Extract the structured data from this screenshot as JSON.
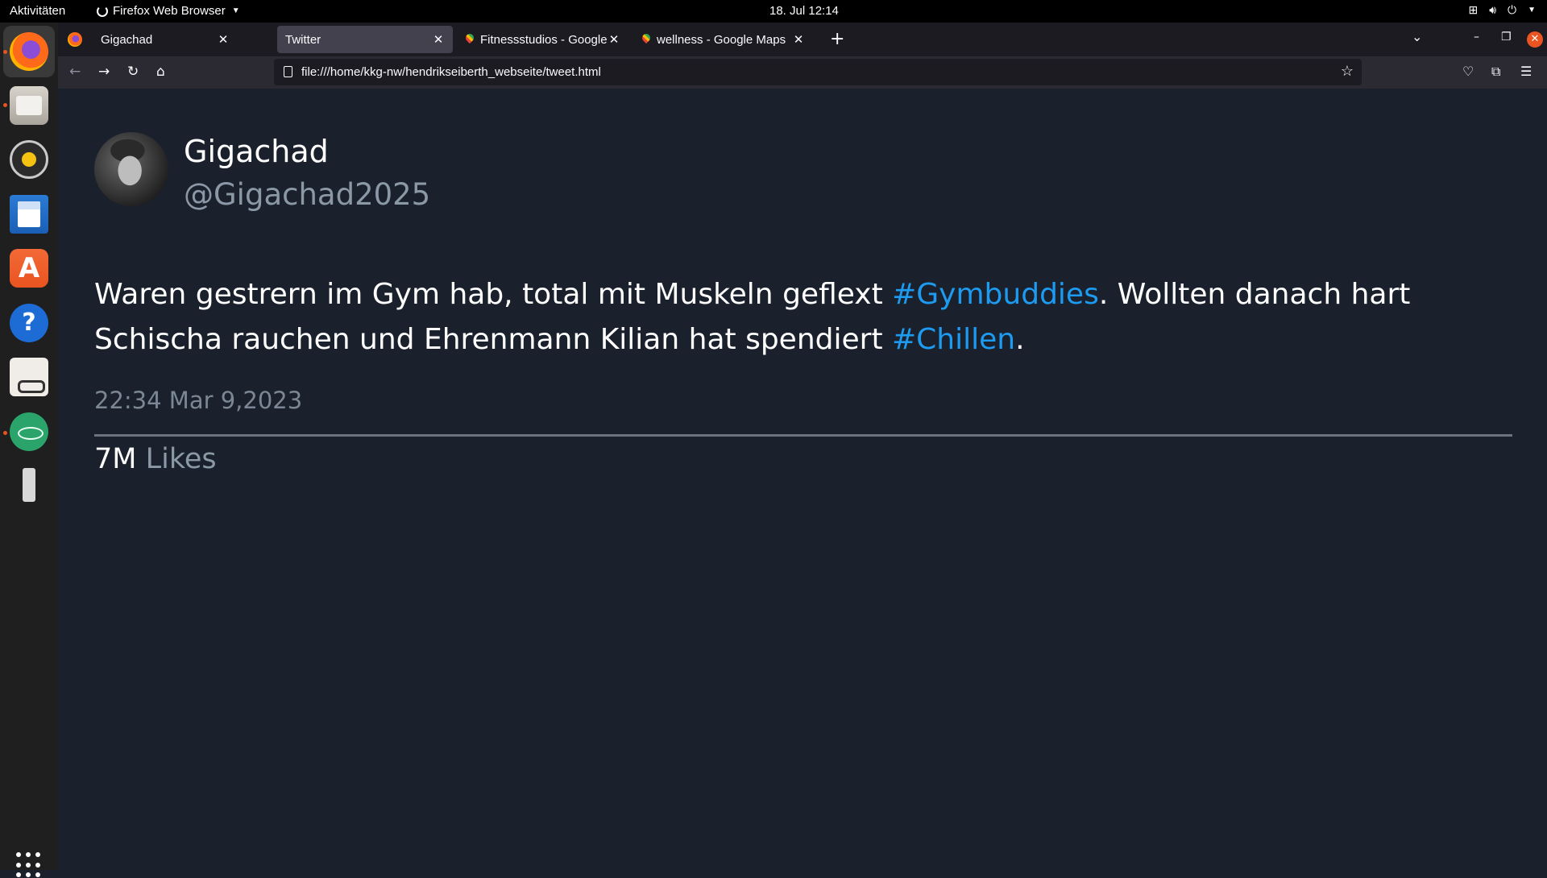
{
  "topbar": {
    "activities": "Aktivitäten",
    "app_name": "Firefox Web Browser",
    "clock": "18. Jul  12:14"
  },
  "dock": {
    "items": [
      "firefox-icon",
      "files-icon",
      "rhythmbox-icon",
      "libreoffice-writer-icon",
      "ubuntu-software-icon",
      "help-icon",
      "document-viewer-icon",
      "atom-icon",
      "usb-drive-icon",
      "show-apps-icon"
    ]
  },
  "browser": {
    "tabs": [
      {
        "title": "Gigachad",
        "active": false
      },
      {
        "title": "Twitter",
        "active": true
      },
      {
        "title": "Fitnessstudios - Google M",
        "active": false
      },
      {
        "title": "wellness - Google Maps",
        "active": false
      }
    ],
    "new_tab": "+",
    "url": "file:///home/kkg-nw/hendrikseiberth_webseite/tweet.html"
  },
  "tweet": {
    "display_name": "Gigachad",
    "handle": "@Gigachad2025",
    "text_part1": "Waren gestrern im Gym hab, total mit Muskeln geflext ",
    "hashtag1": "#Gymbuddies",
    "text_part2": ". Wollten danach hart Schischa rauchen und Ehrenmann Kilian hat spendiert ",
    "hashtag2": "#Chillen",
    "text_part3": ".",
    "timestamp": "22:34 Mar 9,2023",
    "likes_count": "7M",
    "likes_label": "Likes"
  },
  "colors": {
    "page_bg": "#1b212c",
    "hashtag": "#1d9bf0",
    "secondary_text": "#8b98a5",
    "accent": "#e95420"
  }
}
